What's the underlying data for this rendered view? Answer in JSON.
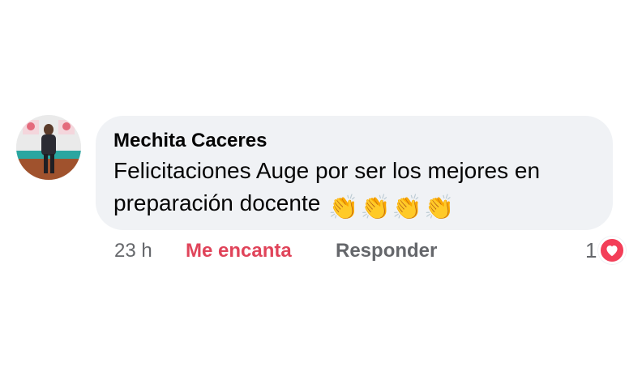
{
  "comment": {
    "author": "Mechita Caceres",
    "text": "Felicitaciones Auge por ser los mejores en preparación docente",
    "emojis": [
      "👏",
      "👏",
      "👏",
      "👏"
    ],
    "time": "23 h",
    "reaction_label": "Me encanta",
    "reply_label": "Responder",
    "reaction_count": "1"
  },
  "colors": {
    "bubble": "#f0f2f5",
    "love": "#e0445a",
    "muted": "#65676b",
    "heart_badge": "#f33e58"
  },
  "icons": {
    "avatar": "profile-photo",
    "reaction": "heart-icon"
  }
}
